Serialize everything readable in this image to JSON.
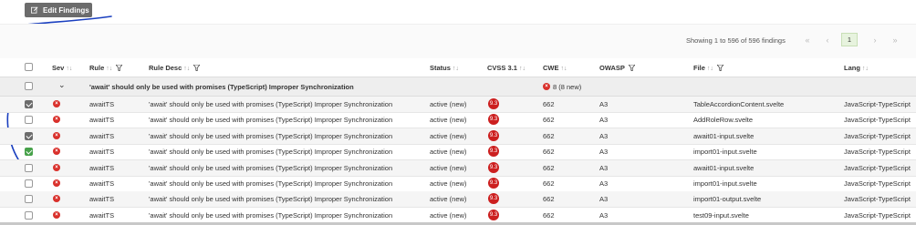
{
  "toolbar": {
    "edit_label": "Edit Findings"
  },
  "pagination": {
    "showing": "Showing 1 to 596 of 596 findings",
    "first": "«",
    "prev": "‹",
    "current": "1",
    "next": "›",
    "last": "»"
  },
  "columns": {
    "sev": "Sev",
    "rule": "Rule",
    "rule_desc": "Rule Desc",
    "status": "Status",
    "cvss": "CVSS 3.1",
    "cwe": "CWE",
    "owasp": "OWASP",
    "file": "File",
    "lang": "Lang",
    "sort_glyph": "↑↓"
  },
  "group": {
    "title": "'await' should only be used with promises (TypeScript) Improper Synchronization",
    "count": "8 (8 new)",
    "chevron": "⌄"
  },
  "rows": [
    {
      "checked": true,
      "rule": "awaitTS",
      "desc": "'await' should only be used with promises (TypeScript) Improper Synchronization",
      "status": "active (new)",
      "cvss": "9.3",
      "cwe": "662",
      "owasp": "A3",
      "file": "TableAccordionContent.svelte",
      "lang": "JavaScript-TypeScript"
    },
    {
      "checked": false,
      "rule": "awaitTS",
      "desc": "'await' should only be used with promises (TypeScript) Improper Synchronization",
      "status": "active (new)",
      "cvss": "9.3",
      "cwe": "662",
      "owasp": "A3",
      "file": "AddRoleRow.svelte",
      "lang": "JavaScript-TypeScript"
    },
    {
      "checked": true,
      "rule": "awaitTS",
      "desc": "'await' should only be used with promises (TypeScript) Improper Synchronization",
      "status": "active (new)",
      "cvss": "9.3",
      "cwe": "662",
      "owasp": "A3",
      "file": "await01-input.svelte",
      "lang": "JavaScript-TypeScript"
    },
    {
      "checked": true,
      "rule": "awaitTS",
      "desc": "'await' should only be used with promises (TypeScript) Improper Synchronization",
      "status": "active (new)",
      "cvss": "9.3",
      "cwe": "662",
      "owasp": "A3",
      "file": "import01-input.svelte",
      "lang": "JavaScript-TypeScript"
    },
    {
      "checked": false,
      "rule": "awaitTS",
      "desc": "'await' should only be used with promises (TypeScript) Improper Synchronization",
      "status": "active (new)",
      "cvss": "9.3",
      "cwe": "662",
      "owasp": "A3",
      "file": "await01-input.svelte",
      "lang": "JavaScript-TypeScript"
    },
    {
      "checked": false,
      "rule": "awaitTS",
      "desc": "'await' should only be used with promises (TypeScript) Improper Synchronization",
      "status": "active (new)",
      "cvss": "9.3",
      "cwe": "662",
      "owasp": "A3",
      "file": "import01-input.svelte",
      "lang": "JavaScript-TypeScript"
    },
    {
      "checked": false,
      "rule": "awaitTS",
      "desc": "'await' should only be used with promises (TypeScript) Improper Synchronization",
      "status": "active (new)",
      "cvss": "9.3",
      "cwe": "662",
      "owasp": "A3",
      "file": "import01-output.svelte",
      "lang": "JavaScript-TypeScript"
    },
    {
      "checked": false,
      "rule": "awaitTS",
      "desc": "'await' should only be used with promises (TypeScript) Improper Synchronization",
      "status": "active (new)",
      "cvss": "9.3",
      "cwe": "662",
      "owasp": "A3",
      "file": "test09-input.svelte",
      "lang": "JavaScript-TypeScript"
    }
  ],
  "colors": {
    "severity": "#d9302b",
    "cvss_badge": "#cc1f1f",
    "annotation_ink": "#1a3fbf"
  }
}
